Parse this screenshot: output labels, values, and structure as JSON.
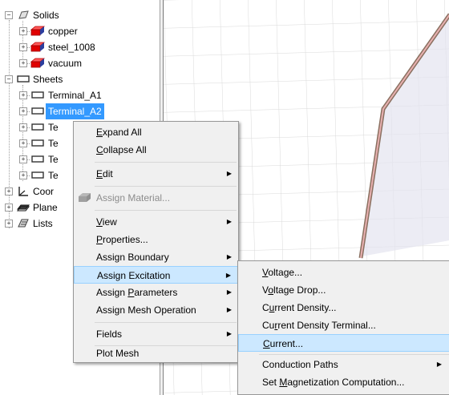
{
  "tree": {
    "items": [
      {
        "label": "Solids",
        "icon": "solids-folder-icon"
      },
      {
        "label": "copper",
        "icon": "material-box-icon"
      },
      {
        "label": "steel_1008",
        "icon": "material-box-icon"
      },
      {
        "label": "vacuum",
        "icon": "material-box-icon"
      },
      {
        "label": "Sheets",
        "icon": "sheet-icon"
      },
      {
        "label": "Terminal_A1",
        "icon": "sheet-icon"
      },
      {
        "label": "Terminal_A2",
        "icon": "sheet-icon"
      },
      {
        "label": "Te",
        "icon": "sheet-icon"
      },
      {
        "label": "Te",
        "icon": "sheet-icon"
      },
      {
        "label": "Te",
        "icon": "sheet-icon"
      },
      {
        "label": "Te",
        "icon": "sheet-icon"
      },
      {
        "label": "Coor",
        "icon": "coordinate-system-icon"
      },
      {
        "label": "Plane",
        "icon": "planes-icon"
      },
      {
        "label": "Lists",
        "icon": "lists-icon"
      }
    ],
    "selected": "Terminal_A2"
  },
  "context_menu": {
    "items": [
      {
        "mnem": "E",
        "rest": "xpand All"
      },
      {
        "mnem": "C",
        "rest": "ollapse All"
      },
      {
        "mnem": "E",
        "rest": "dit"
      },
      {
        "mnem": "",
        "rest": "Assign Material..."
      },
      {
        "mnem": "V",
        "rest": "iew"
      },
      {
        "mnem": "P",
        "rest": "roperties..."
      },
      {
        "mnem": "",
        "rest": "Assign Boundary"
      },
      {
        "mnem": "",
        "rest": "Assign Excitation"
      },
      {
        "pre": "Assign ",
        "mnem": "P",
        "rest": "arameters"
      },
      {
        "mnem": "",
        "rest": "Assign Mesh Operation"
      },
      {
        "mnem": "",
        "rest": "Fields"
      },
      {
        "mnem": "",
        "rest": "Plot Mesh"
      }
    ]
  },
  "submenu": {
    "items": [
      {
        "pre": "",
        "mnem": "V",
        "rest": "oltage..."
      },
      {
        "pre": "V",
        "mnem": "o",
        "rest": "ltage Drop..."
      },
      {
        "pre": "C",
        "mnem": "u",
        "rest": "rrent Density..."
      },
      {
        "pre": "Cu",
        "mnem": "r",
        "rest": "rent Density Terminal..."
      },
      {
        "pre": "",
        "mnem": "C",
        "rest": "urrent..."
      },
      {
        "pre": "",
        "mnem": "",
        "rest": "Conduction Paths"
      },
      {
        "pre": "Set ",
        "mnem": "M",
        "rest": "agnetization Computation..."
      }
    ]
  }
}
